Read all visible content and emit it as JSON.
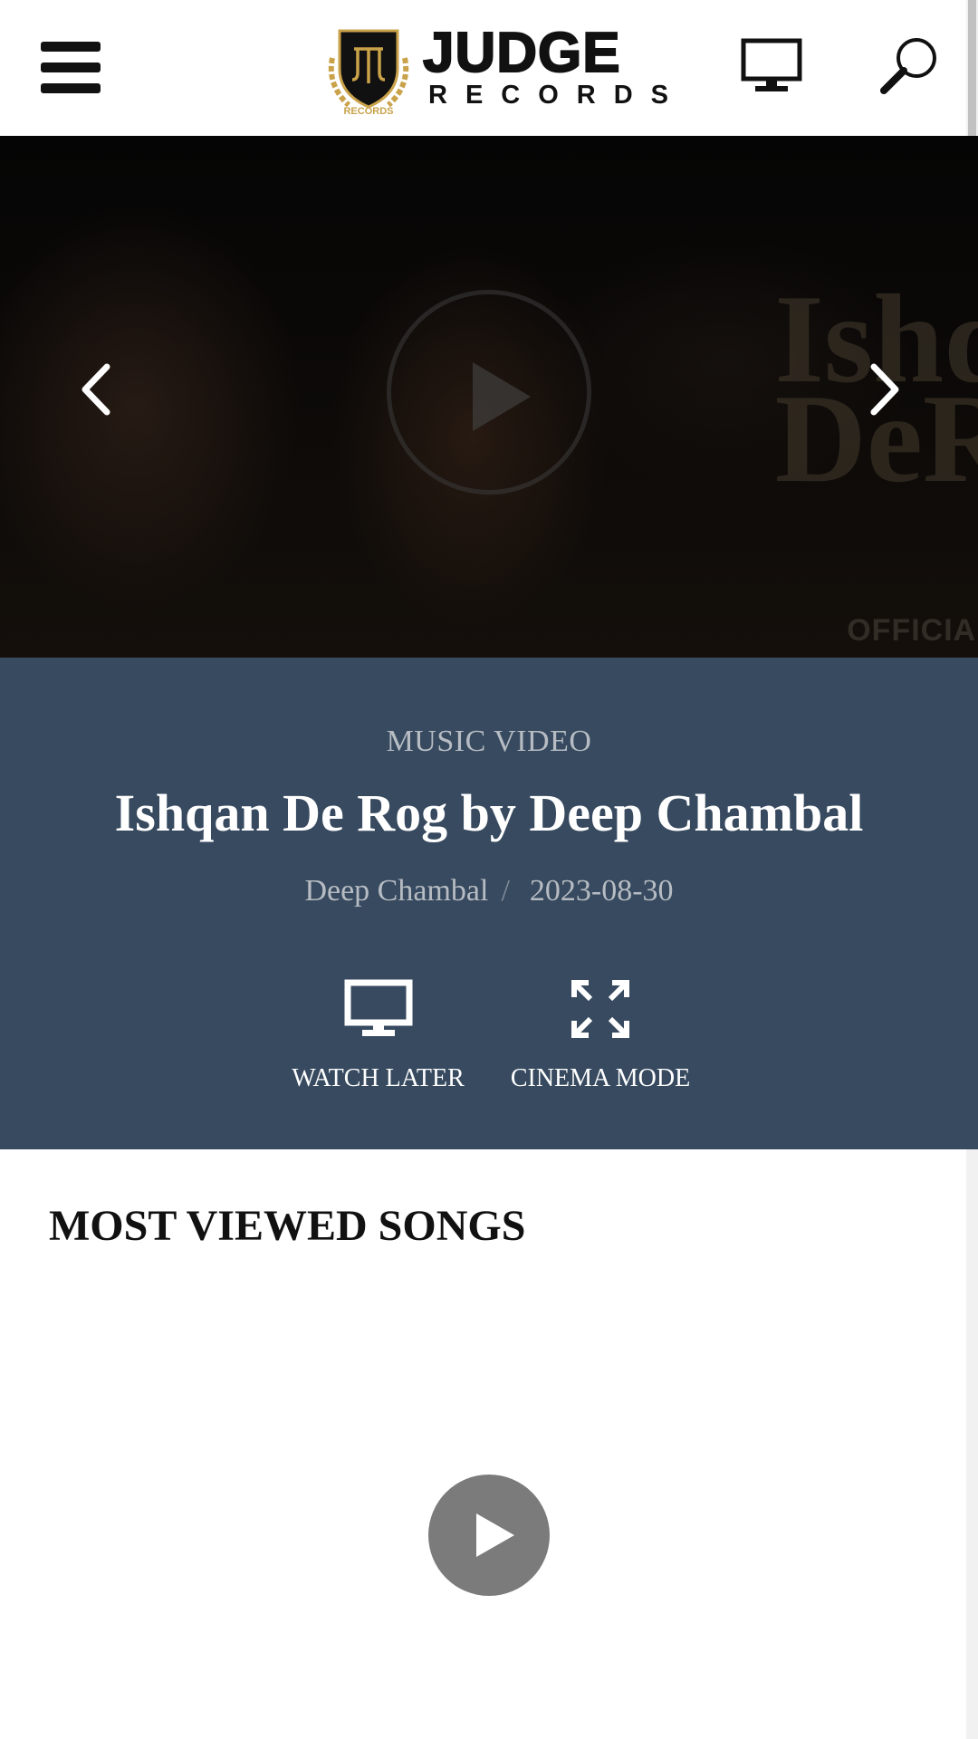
{
  "header": {
    "logo_main": "JUDGE",
    "logo_sub": "RECORDS",
    "logo_emblem_text": "RECORDS",
    "icons": {
      "menu": "hamburger-menu-icon",
      "watch_later": "tv-monitor-icon",
      "search": "search-icon"
    }
  },
  "hero": {
    "overlay_title": "Ishq\nDeR",
    "overlay_official": "OFFICIAL",
    "prev_icon": "chevron-left-icon",
    "next_icon": "chevron-right-icon",
    "play_icon": "play-icon"
  },
  "video": {
    "category": "MUSIC VIDEO",
    "title": "Ishqan De Rog by Deep Chambal",
    "artist": "Deep Chambal",
    "separator": "/",
    "date": "2023-08-30"
  },
  "actions": {
    "watch_later": "WATCH LATER",
    "cinema_mode": "CINEMA MODE"
  },
  "most_viewed": {
    "heading": "MOST VIEWED SONGS",
    "play_icon": "play-icon"
  },
  "colors": {
    "panel_bg": "#374a5f",
    "muted_text": "#b7bcc3",
    "play_button_bg": "#7b7b7b",
    "logo_gold": "#c9a24a"
  }
}
